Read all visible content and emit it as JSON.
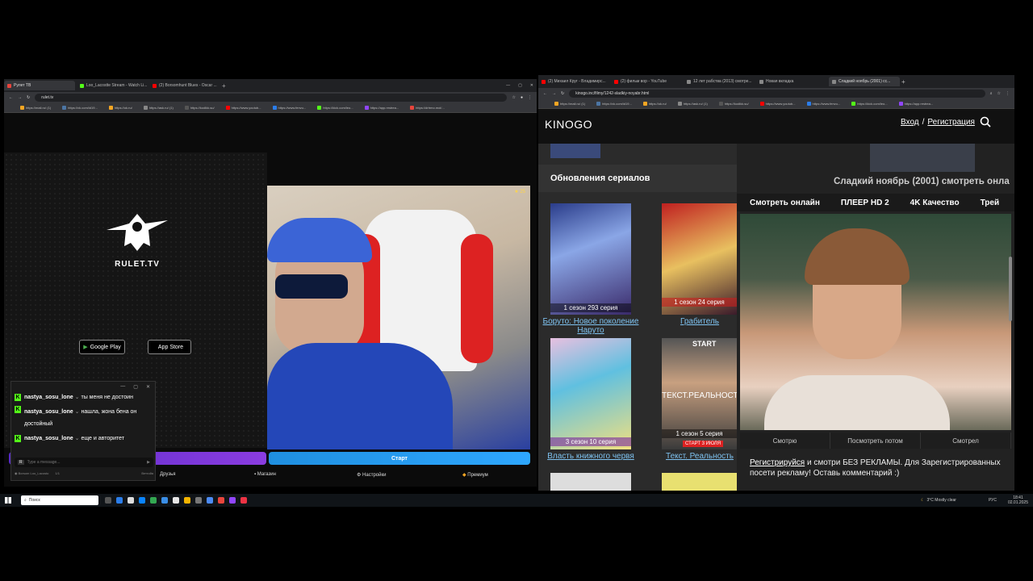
{
  "left_browser": {
    "tabs": [
      {
        "label": "Рулет ТВ",
        "color": "#e8453c"
      },
      {
        "label": "Loo_Lacostte Stream - Watch Li...",
        "color": "#53fc18"
      },
      {
        "label": "(2) Borsomhunt Blues - Oscar ...",
        "color": "#ff0000"
      }
    ],
    "url": "rulet.tv",
    "bookmarks": [
      "https://mail.ru/ (1)",
      "https://vk.com/id19...",
      "https://ok.ru/",
      "https://ask.ru/ (1)",
      "https://kodikk.su/",
      "https://www.youtub...",
      "https://www.fenvu...",
      "https://kick.com/leo...",
      "https://app.restrea...",
      "https://drtrmo.mol/..."
    ],
    "logo_text": "RULET.TV",
    "google_play": "Google Play",
    "app_store": "App Store",
    "cam_counter": "25",
    "start_button": "Старт",
    "nav": {
      "friends": "Друзья",
      "shop": "Магазин",
      "settings": "Настройки",
      "premium": "Премиум"
    }
  },
  "chat": {
    "messages": [
      {
        "user": "nastya_sosu_lone",
        "text": "ты меня не достоин"
      },
      {
        "user": "nastya_sosu_lone",
        "text": "нашла, жона бена он достойный"
      },
      {
        "user": "nastya_sosu_lone",
        "text": "еще и авторитет"
      }
    ],
    "placeholder": "Type a message...",
    "footer_user": "Borsom Loo_Lacosto",
    "footer_count": "1/1",
    "footer_right": "Ветгойя"
  },
  "right_browser": {
    "tabs": [
      {
        "label": "(2) Михаил Круг - Владимирс...",
        "color": "#ff0000"
      },
      {
        "label": "(2) фильм вор - YouTube",
        "color": "#ff0000"
      },
      {
        "label": "12 лет рабства (2013) смотре...",
        "color": "#888888"
      },
      {
        "label": "Новая вкладка",
        "color": "#888888"
      },
      {
        "label": "Сладкий ноябрь (2001) сс...",
        "color": "#888888"
      }
    ],
    "url": "kinogo.inc/filmy/1242-sladkiy-noyabr.html",
    "site_name": "KINOGO",
    "login": "Вход",
    "register": "Регистрация",
    "section_title": "Обновления сериалов",
    "posters": [
      {
        "badge": "1 сезон 293 серия",
        "title": "Боруто: Новое поколение Наруто"
      },
      {
        "badge": "1 сезон 24 серия",
        "title": "Грабитель"
      },
      {
        "badge": "3 сезон 10 серия",
        "title": "Власть книжного червя"
      },
      {
        "badge": "1 сезон 5 серия",
        "title": "Текст. Реальность",
        "extra": "СТАРТ 3 ИЮЛЯ",
        "poster_text": "ТЕКСТ.РЕАЛЬНОСТЬ",
        "start": "START"
      }
    ],
    "movie_title": "Сладкий ноябрь (2001) смотреть онла",
    "player_tabs": [
      "Смотреть онлайн",
      "ПЛЕЕР HD 2",
      "4K Качество",
      "Трей"
    ],
    "watch_buttons": [
      "Смотрю",
      "Посмотреть потом",
      "Смотрел"
    ],
    "register_link": "Регистрируйся",
    "promo_text": " и смотри БЕЗ РЕКЛАМЫ. Для Зарегистрированных посети рекламу! Оставь комментарий :)"
  },
  "taskbar": {
    "search": "Поиск",
    "weather": "3°C Mostly clear",
    "lang": "РУС",
    "time": "18:41",
    "date": "02.01.2025"
  }
}
